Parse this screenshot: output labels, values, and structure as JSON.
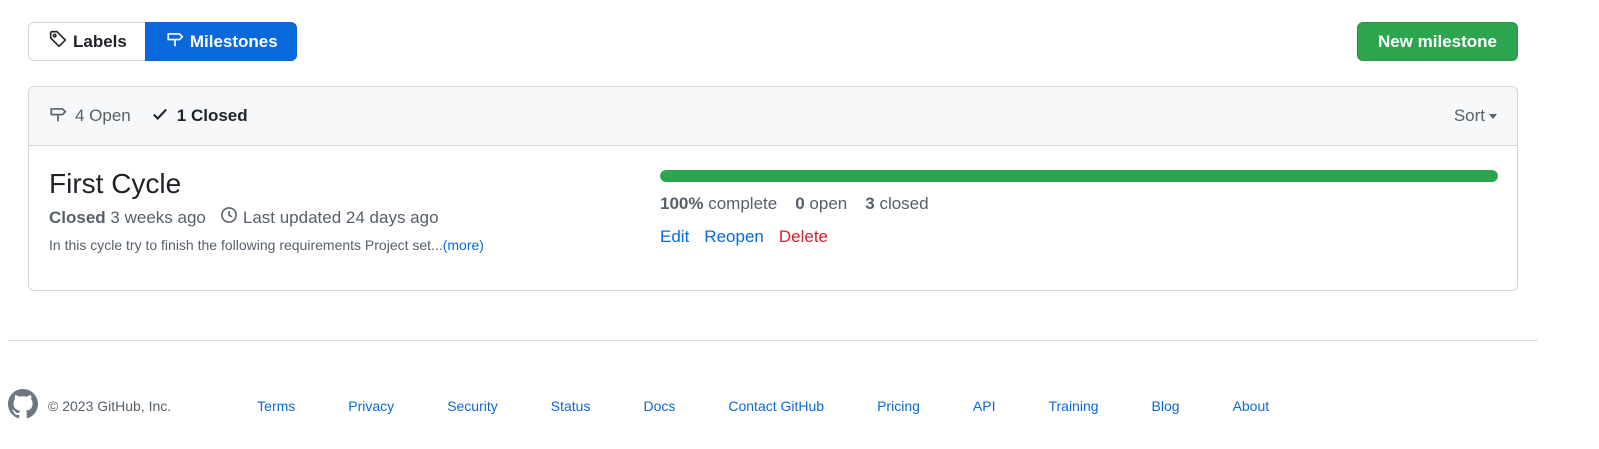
{
  "tabs": {
    "labels": "Labels",
    "milestones": "Milestones"
  },
  "new_button": "New milestone",
  "header": {
    "open_label": "4 Open",
    "closed_label": "1 Closed",
    "sort_label": "Sort"
  },
  "milestone": {
    "title": "First Cycle",
    "status": "Closed",
    "closed_ago": "3 weeks ago",
    "updated": "Last updated 24 days ago",
    "description": "In this cycle try to finish the following requirements Project set...",
    "more": "(more)",
    "progress_percent": 100,
    "percent_label": "100%",
    "complete_label": "complete",
    "open_count": "0",
    "open_label": "open",
    "closed_count": "3",
    "closed_label": "closed",
    "actions": {
      "edit": "Edit",
      "reopen": "Reopen",
      "delete": "Delete"
    }
  },
  "footer": {
    "copyright": "© 2023 GitHub, Inc.",
    "links": [
      "Terms",
      "Privacy",
      "Security",
      "Status",
      "Docs",
      "Contact GitHub",
      "Pricing",
      "API",
      "Training",
      "Blog",
      "About"
    ]
  },
  "colors": {
    "accent": "#0969da",
    "success": "#2da44e",
    "danger": "#cf222e"
  },
  "icons": {
    "labels": "tag-icon",
    "milestones": "milestone-icon",
    "closed": "check-icon",
    "updated": "clock-icon",
    "footer": "github-logo-icon"
  }
}
